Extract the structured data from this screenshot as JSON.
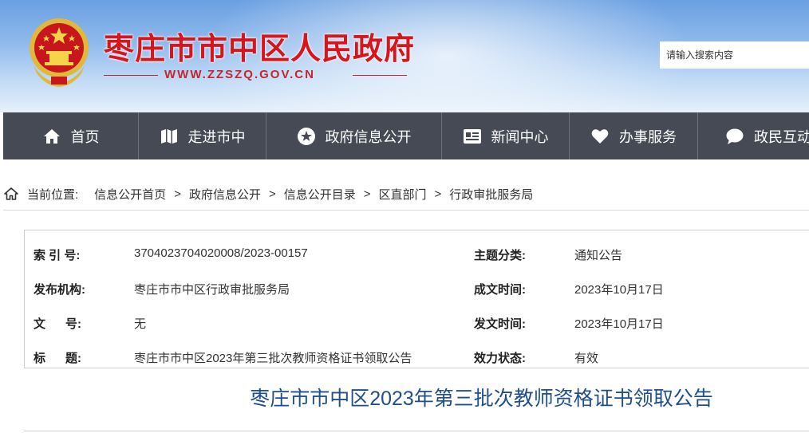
{
  "header": {
    "site_title": "枣庄市市中区人民政府",
    "site_domain": "WWW.ZZSZQ.GOV.CN",
    "search_placeholder": "请输入搜索内容"
  },
  "nav": [
    {
      "label": "首页",
      "icon": "home-icon",
      "width": 170
    },
    {
      "label": "走进市中",
      "icon": "map-icon",
      "width": 160
    },
    {
      "label": "政府信息公开",
      "icon": "star-icon",
      "width": 220
    },
    {
      "label": "新闻中心",
      "icon": "newspaper-icon",
      "width": 160
    },
    {
      "label": "办事服务",
      "icon": "heart-icon",
      "width": 161
    },
    {
      "label": "政民互动",
      "icon": "chat-icon",
      "width": 139
    }
  ],
  "breadcrumb": {
    "lead": "当前位置:",
    "items": [
      "信息公开首页",
      "政府信息公开",
      "信息公开目录",
      "区直部门",
      "行政审批服务局"
    ],
    "separator": ">"
  },
  "meta": {
    "index_label": "索 引 号:",
    "index_value": "3704023704020008/2023-00157",
    "category_label": "主题分类:",
    "category_value": "通知公告",
    "publisher_label": "发布机构:",
    "publisher_value": "枣庄市市中区行政审批服务局",
    "created_label": "成文时间:",
    "created_value": "2023年10月17日",
    "docno_label": "文      号:",
    "docno_value": "无",
    "issued_label": "发文时间:",
    "issued_value": "2023年10月17日",
    "title_label": "标      题:",
    "title_value": "枣庄市市中区2023年第三批次教师资格证书领取公告",
    "status_label": "效力状态:",
    "status_value": "有效"
  },
  "article": {
    "title": "枣庄市市中区2023年第三批次教师资格证书领取公告"
  },
  "colors": {
    "title_red": "#d8151b",
    "nav_bg": "#454a54",
    "article_title_blue": "#1f4f8b"
  }
}
